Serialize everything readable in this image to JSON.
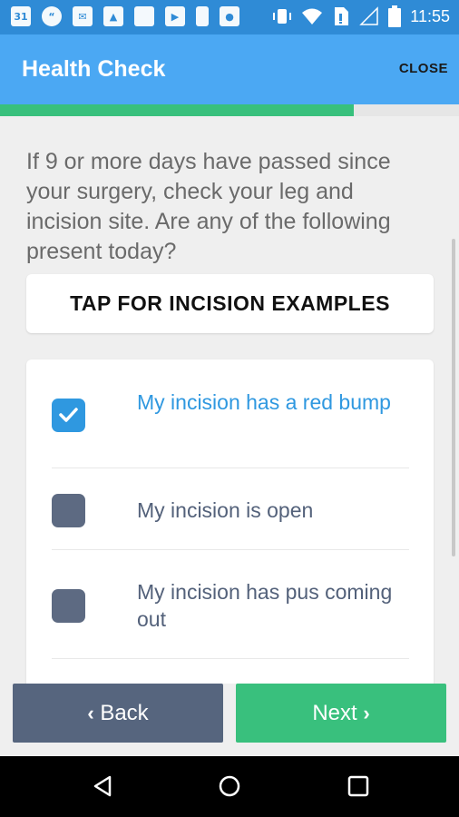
{
  "status_bar": {
    "time": "11:55",
    "left_icons": [
      "calendar-icon",
      "hangouts-icon",
      "gmail-icon",
      "photos-icon",
      "square-icon",
      "youtube-icon",
      "phone-icon",
      "camera-icon"
    ],
    "right_icons": [
      "vibrate-icon",
      "wifi-icon",
      "no-sim-icon",
      "signal-icon",
      "battery-icon"
    ],
    "calendar_day": "31"
  },
  "app_bar": {
    "title": "Health Check",
    "close_label": "CLOSE"
  },
  "progress": {
    "fraction": 0.77,
    "track_color": "#e6e6e6",
    "fill_color": "#38c07c"
  },
  "question": "If 9 or more days have passed since your surgery, check your leg and incision site. Are any of the following present today?",
  "examples_button_label": "TAP FOR INCISION EXAMPLES",
  "options": [
    {
      "label": "My incision has a red bump",
      "checked": true
    },
    {
      "label": "My incision is open",
      "checked": false
    },
    {
      "label": "My incision has pus coming out",
      "checked": false
    }
  ],
  "footer": {
    "back_label": "Back",
    "next_label": "Next"
  },
  "colors": {
    "app_bar": "#4ba8f3",
    "status_bar": "#2f8bd6",
    "checked": "#2f98e0",
    "unchecked": "#5d6a82",
    "next": "#39c07d",
    "back": "#56657e"
  }
}
